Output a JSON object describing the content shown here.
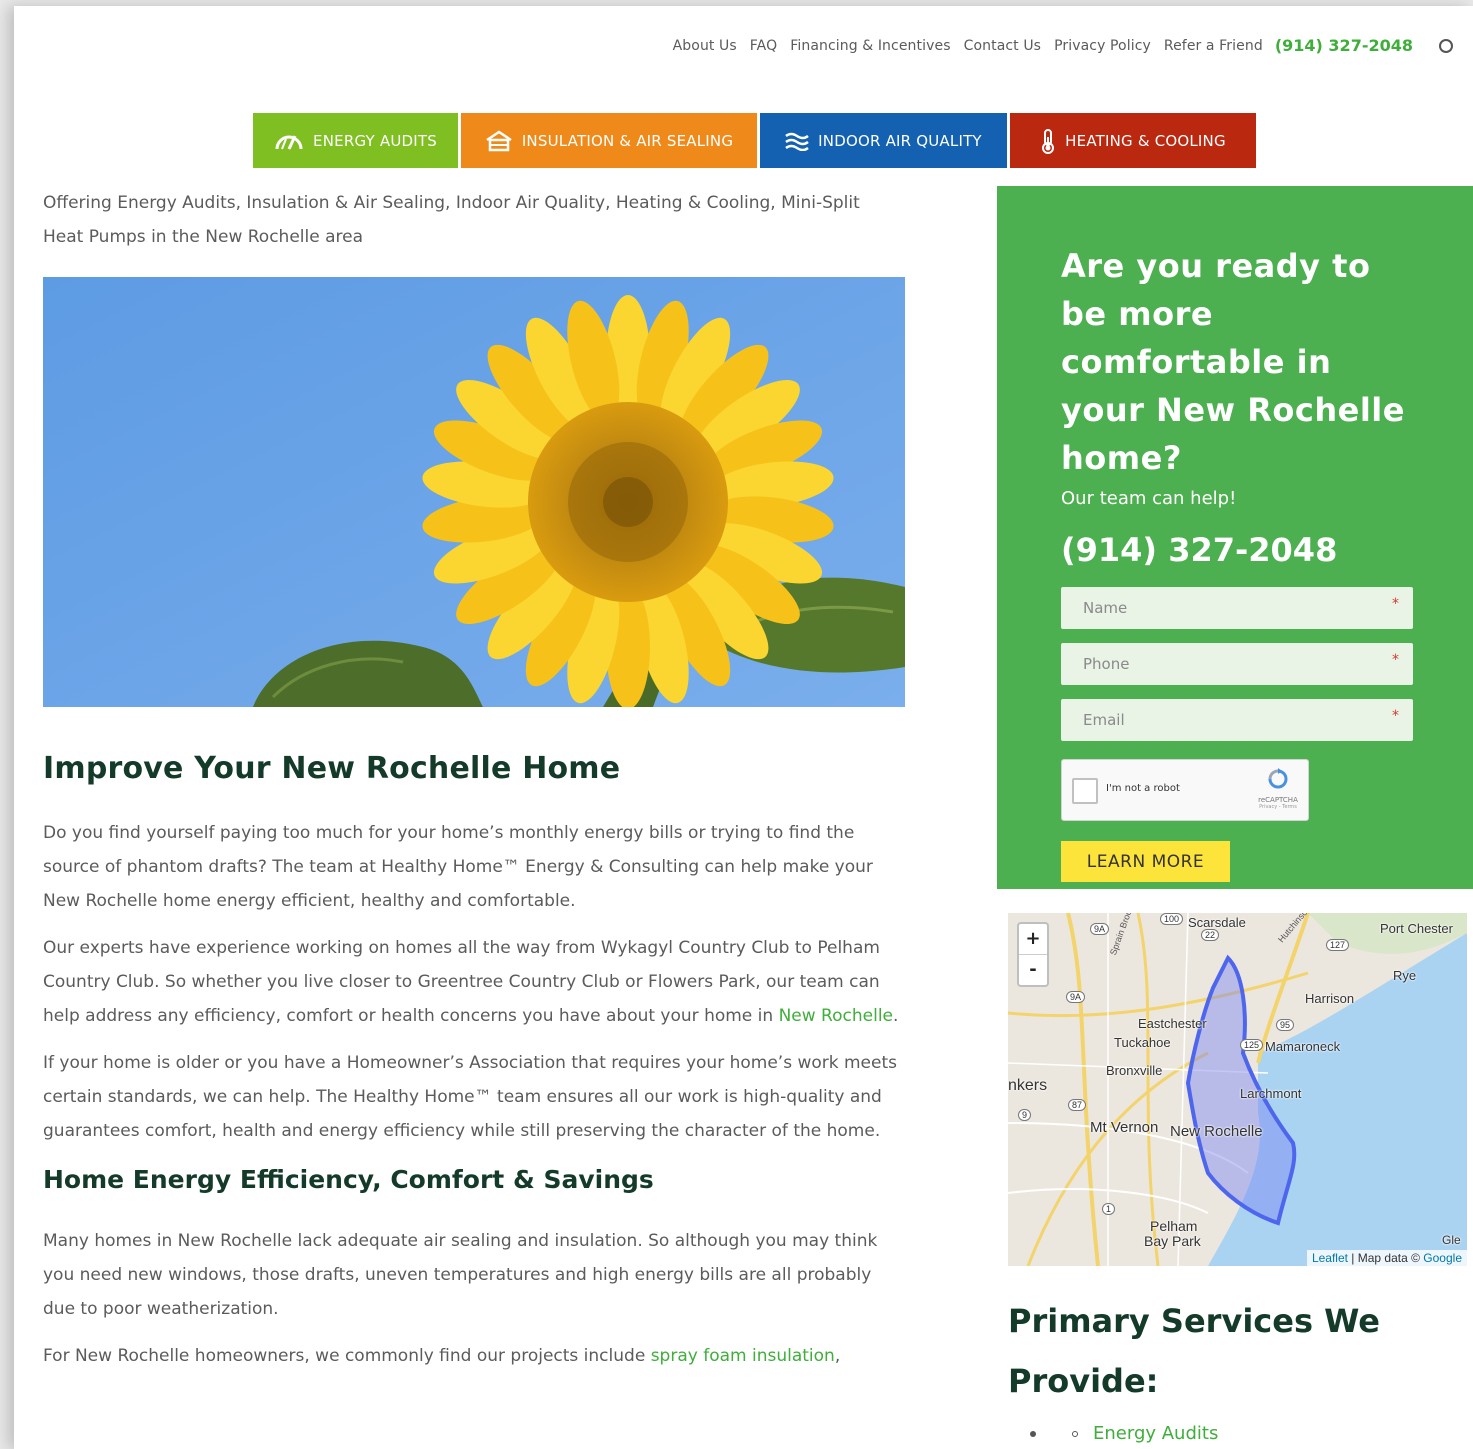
{
  "topnav": {
    "links": [
      "About Us",
      "FAQ",
      "Financing & Incentives",
      "Contact Us",
      "Privacy Policy",
      "Refer a Friend"
    ],
    "phone": "(914) 327-2048"
  },
  "tabs": [
    {
      "label": "ENERGY AUDITS",
      "icon": "gauge-icon",
      "color": "#7fbf22"
    },
    {
      "label": "INSULATION & AIR SEALING",
      "icon": "house-icon",
      "color": "#ef8a1a"
    },
    {
      "label": "INDOOR AIR QUALITY",
      "icon": "air-waves-icon",
      "color": "#1361b0"
    },
    {
      "label": "HEATING & COOLING",
      "icon": "thermometer-icon",
      "color": "#b9280f"
    }
  ],
  "main": {
    "intro": "Offering Energy Audits, Insulation & Air Sealing, Indoor Air Quality, Heating & Cooling, Mini-Split Heat Pumps in the New Rochelle area",
    "hero_alt": "sunflower against blue sky",
    "heading": "Improve Your New Rochelle Home",
    "p1": "Do you find yourself paying too much for your home’s monthly energy bills or trying to find the source of phantom drafts? The team at Healthy Home™ Energy & Consulting can help make your New Rochelle home energy efficient, healthy and comfortable.",
    "p2_text": "Our experts have experience working on homes all the way from Wykagyl Country Club to Pelham Country Club.  So whether you live closer to Greentree Country Club or Flowers Park, our team can help address any efficiency, comfort or health concerns you have about your home in ",
    "p2_link": "New Rochelle",
    "p2_end": ".",
    "p3": "If your home is older or you have a Homeowner’s Association that requires your home’s work meets certain standards, we can help. The Healthy Home™ team ensures all our work is high-quality and guarantees comfort, health and energy efficiency while still preserving the character of the home.",
    "subheading": "Home Energy Efficiency, Comfort & Savings",
    "p4": "Many homes in New Rochelle lack adequate air sealing and insulation. So although you may think you need new windows, those drafts, uneven temperatures and high energy bills are all probably due to poor weatherization.",
    "p5_text": "For New Rochelle homeowners, we commonly find our projects include ",
    "p5_link": "spray foam insulation",
    "p5_end": ","
  },
  "cta": {
    "title": "Are you ready to be more comfortable in your New Rochelle home?",
    "subtitle": "Our team can help!",
    "phone": "(914) 327-2048",
    "fields": [
      {
        "placeholder": "Name",
        "value": ""
      },
      {
        "placeholder": "Phone",
        "value": ""
      },
      {
        "placeholder": "Email",
        "value": ""
      }
    ],
    "required_mark": "*",
    "captcha_label": "I'm not a robot",
    "captcha_brand": "reCAPTCHA",
    "captcha_terms": "Privacy - Terms",
    "button": "LEARN MORE",
    "bg_color": "#4caf50",
    "button_color": "#fde43a"
  },
  "map": {
    "zoom_in": "+",
    "zoom_out": "-",
    "places": [
      "Scarsdale",
      "Port Chester",
      "Rye",
      "Harrison",
      "Eastchester",
      "Tuckahoe",
      "Mamaroneck",
      "Bronxville",
      "Larchmont",
      "nkers",
      "Mt Vernon",
      "New Rochelle",
      "Pelham",
      "Bay Park",
      "Gle"
    ],
    "road_labels": [
      "100",
      "22",
      "9A",
      "9A",
      "127",
      "95",
      "125",
      "87",
      "9",
      "1",
      "Sprain Brook Pkwy",
      "Hutchinson River P"
    ],
    "attribution_leaflet": "Leaflet",
    "attribution_sep": " | Map data © ",
    "attribution_google": "Google"
  },
  "services": {
    "title": "Primary Services We Provide:",
    "items": [
      "Energy Audits"
    ]
  }
}
